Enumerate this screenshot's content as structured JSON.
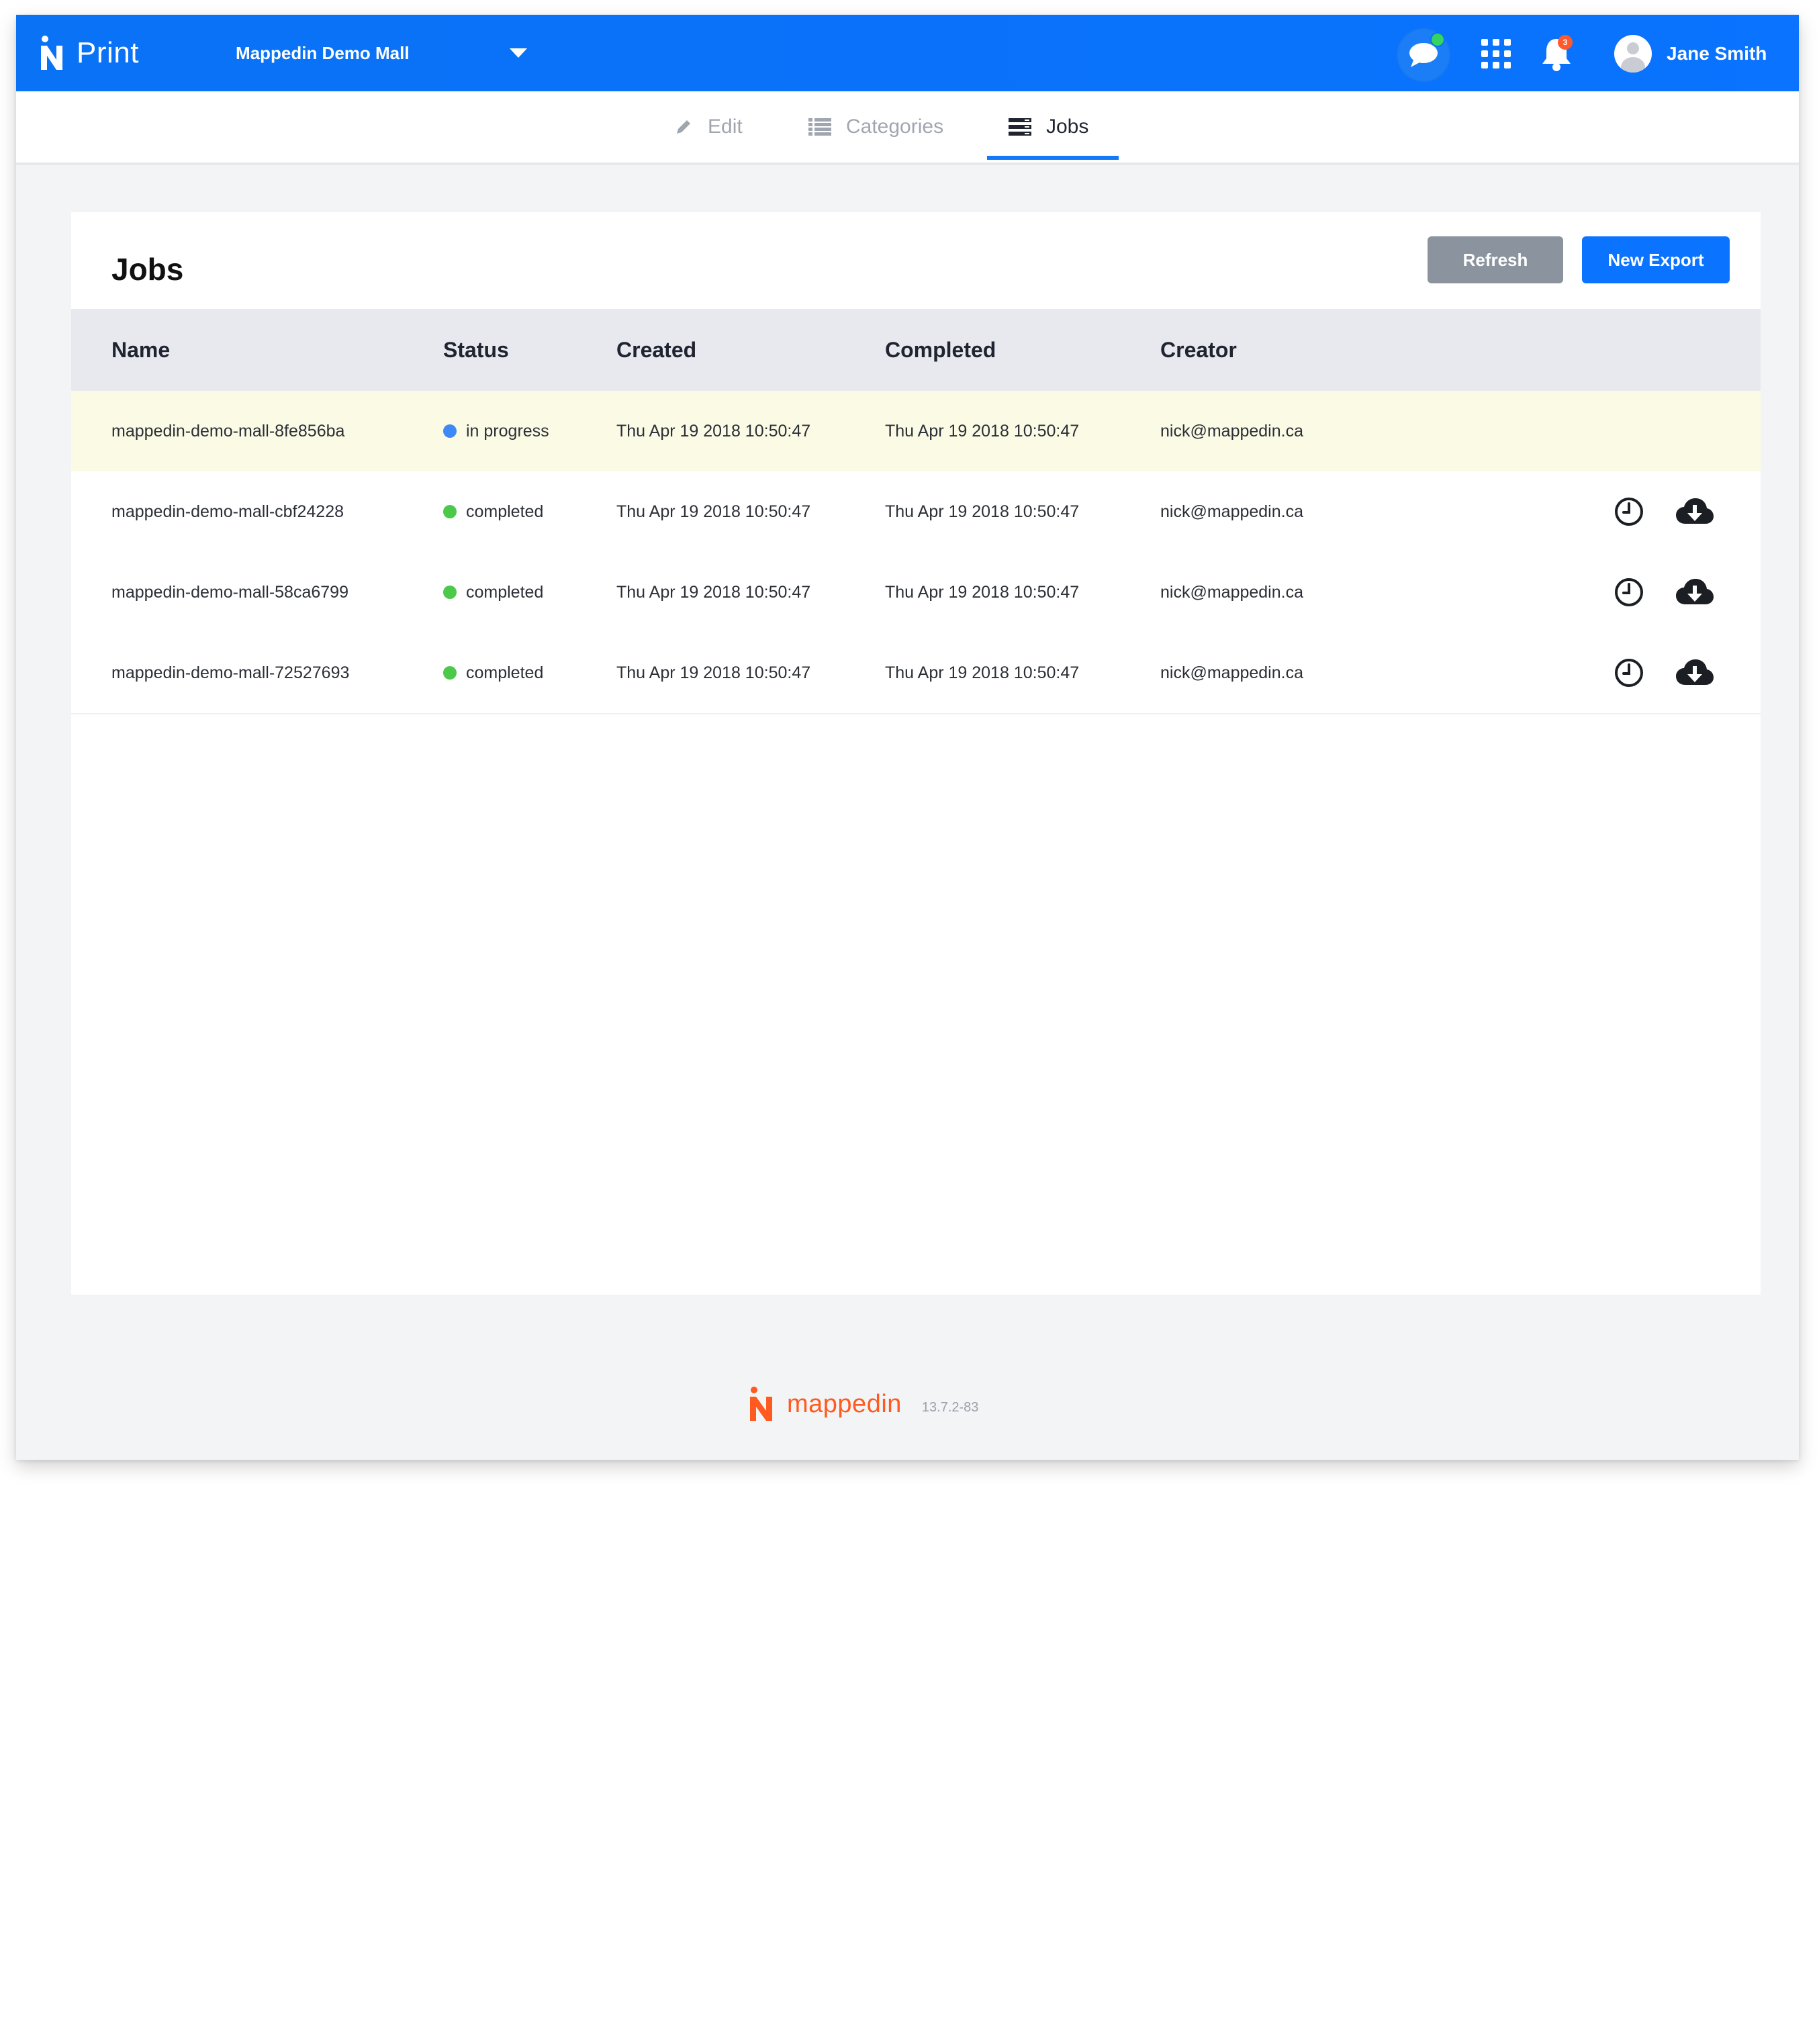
{
  "header": {
    "app_name": "Print",
    "venue_selector": "Mappedin Demo Mall",
    "notification_count": "3",
    "user_name": "Jane Smith",
    "colors": {
      "bar": "#0a73ff",
      "chat_online": "#35d35f",
      "badge": "#ff5a2d"
    }
  },
  "tabs": [
    {
      "label": "Edit",
      "icon": "pencil-icon",
      "active": false
    },
    {
      "label": "Categories",
      "icon": "list-icon",
      "active": false
    },
    {
      "label": "Jobs",
      "icon": "jobs-icon",
      "active": true
    }
  ],
  "card": {
    "title": "Jobs",
    "buttons": {
      "refresh": "Refresh",
      "new_export": "New Export"
    },
    "columns": [
      "Name",
      "Status",
      "Created",
      "Completed",
      "Creator"
    ],
    "rows": [
      {
        "name": "mappedin-demo-mall-8fe856ba",
        "status": "in progress",
        "status_color": "#3d8af7",
        "created": "Thu Apr 19 2018 10:50:47",
        "completed": "Thu Apr 19 2018 10:50:47",
        "creator": "nick@mappedin.ca",
        "highlighted": true,
        "actions": []
      },
      {
        "name": "mappedin-demo-mall-cbf24228",
        "status": "completed",
        "status_color": "#4cc94a",
        "created": "Thu Apr 19 2018 10:50:47",
        "completed": "Thu Apr 19 2018 10:50:47",
        "creator": "nick@mappedin.ca",
        "highlighted": false,
        "actions": [
          "history-icon",
          "cloud-download-icon"
        ]
      },
      {
        "name": "mappedin-demo-mall-58ca6799",
        "status": "completed",
        "status_color": "#4cc94a",
        "created": "Thu Apr 19 2018 10:50:47",
        "completed": "Thu Apr 19 2018 10:50:47",
        "creator": "nick@mappedin.ca",
        "highlighted": false,
        "actions": [
          "history-icon",
          "cloud-download-icon"
        ]
      },
      {
        "name": "mappedin-demo-mall-72527693",
        "status": "completed",
        "status_color": "#4cc94a",
        "created": "Thu Apr 19 2018 10:50:47",
        "completed": "Thu Apr 19 2018 10:50:47",
        "creator": "nick@mappedin.ca",
        "highlighted": false,
        "actions": [
          "history-icon",
          "cloud-download-icon"
        ]
      }
    ]
  },
  "footer": {
    "brand": "mappedin",
    "version": "13.7.2-83",
    "brand_color": "#ff5a1f"
  }
}
